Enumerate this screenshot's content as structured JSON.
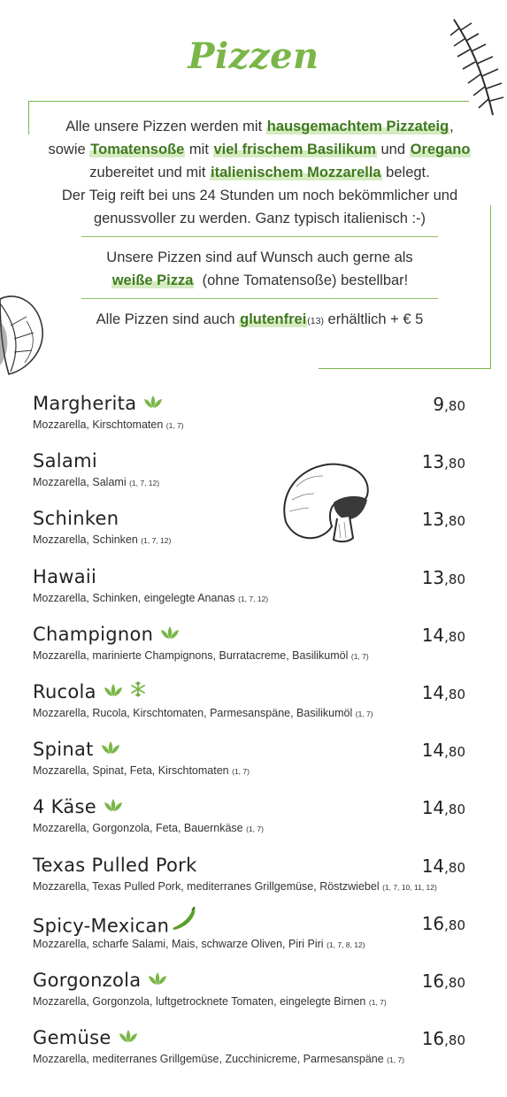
{
  "title": "Pizzen",
  "info": {
    "line1_pre": "Alle unsere Pizzen werden mit ",
    "line1_hl": "hausgemachtem Pizzateig",
    "line1_post": ",",
    "line2_pre": "sowie ",
    "line2_hl1": "Tomatensoße",
    "line2_mid1": " mit ",
    "line2_hl2": "viel frischem Basilikum",
    "line2_mid2": " und ",
    "line2_hl3": "Oregano",
    "line3_pre": "zubereitet und mit ",
    "line3_hl": "italienischem Mozzarella",
    "line3_post": " belegt.",
    "line4": "Der Teig reift bei uns 24 Stunden um noch bekömmlicher und",
    "line5": "genussvoller zu werden. Ganz typisch italienisch :-)",
    "white_pre": "Unsere Pizzen sind auf Wunsch auch gerne als",
    "white_hl": "weiße Pizza",
    "white_post": "(ohne Tomatensoße) bestellbar!",
    "gf_pre": "Alle Pizzen sind auch ",
    "gf_hl": "glutenfrei",
    "gf_code": "(13)",
    "gf_post": " erhältlich + € 5"
  },
  "colors": {
    "accent": "#7ab648",
    "highlight_text": "#3f7a1f",
    "highlight_bg": "#d6ebc2",
    "text": "#222222",
    "chili": "#5aa02c"
  },
  "items": [
    {
      "name": "Margherita",
      "icons": [
        "leaf-icon"
      ],
      "price_int": "9",
      "price_dec": ",80",
      "desc": "Mozzarella, Kirschtomaten",
      "allergens": "(1, 7)"
    },
    {
      "name": "Salami",
      "icons": [],
      "price_int": "13",
      "price_dec": ",80",
      "desc": "Mozzarella, Salami",
      "allergens": "(1, 7, 12)"
    },
    {
      "name": "Schinken",
      "icons": [],
      "price_int": "13",
      "price_dec": ",80",
      "desc": "Mozzarella, Schinken",
      "allergens": "(1, 7, 12)"
    },
    {
      "name": "Hawaii",
      "icons": [],
      "price_int": "13",
      "price_dec": ",80",
      "desc": "Mozzarella, Schinken, eingelegte Ananas",
      "allergens": "(1, 7, 12)"
    },
    {
      "name": "Champignon",
      "icons": [
        "leaf-icon"
      ],
      "price_int": "14",
      "price_dec": ",80",
      "desc": "Mozzarella, marinierte Champignons, Burratacreme, Basilikumöl",
      "allergens": "(1, 7)"
    },
    {
      "name": "Rucola",
      "icons": [
        "leaf-icon",
        "snowflake-icon"
      ],
      "price_int": "14",
      "price_dec": ",80",
      "desc": "Mozzarella, Rucola, Kirschtomaten, Parmesanspäne, Basilikumöl",
      "allergens": "(1, 7)"
    },
    {
      "name": "Spinat",
      "icons": [
        "leaf-icon"
      ],
      "price_int": "14",
      "price_dec": ",80",
      "desc": "Mozzarella, Spinat, Feta, Kirschtomaten",
      "allergens": "(1, 7)"
    },
    {
      "name": "4 Käse",
      "icons": [
        "leaf-icon"
      ],
      "price_int": "14",
      "price_dec": ",80",
      "desc": "Mozzarella, Gorgonzola, Feta, Bauernkäse",
      "allergens": "(1, 7)"
    },
    {
      "name": "Texas Pulled Pork",
      "icons": [],
      "price_int": "14",
      "price_dec": ",80",
      "desc": "Mozzarella, Texas Pulled Pork, mediterranes Grillgemüse, Röstzwiebel",
      "allergens": "(1, 7, 10, 11, 12)"
    },
    {
      "name": "Spicy-Mexican",
      "icons": [
        "chili-icon"
      ],
      "price_int": "16",
      "price_dec": ",80",
      "desc": "Mozzarella, scharfe Salami, Mais, schwarze Oliven, Piri Piri",
      "allergens": "(1, 7, 8, 12)"
    },
    {
      "name": "Gorgonzola",
      "icons": [
        "leaf-icon"
      ],
      "price_int": "16",
      "price_dec": ",80",
      "desc": "Mozzarella, Gorgonzola, luftgetrocknete Tomaten, eingelegte Birnen",
      "allergens": "(1, 7)"
    },
    {
      "name": "Gemüse",
      "icons": [
        "leaf-icon"
      ],
      "price_int": "16",
      "price_dec": ",80",
      "desc": "Mozzarella, mediterranes Grillgemüse, Zucchinicreme, Parmesanspäne",
      "allergens": "(1, 7)"
    }
  ]
}
